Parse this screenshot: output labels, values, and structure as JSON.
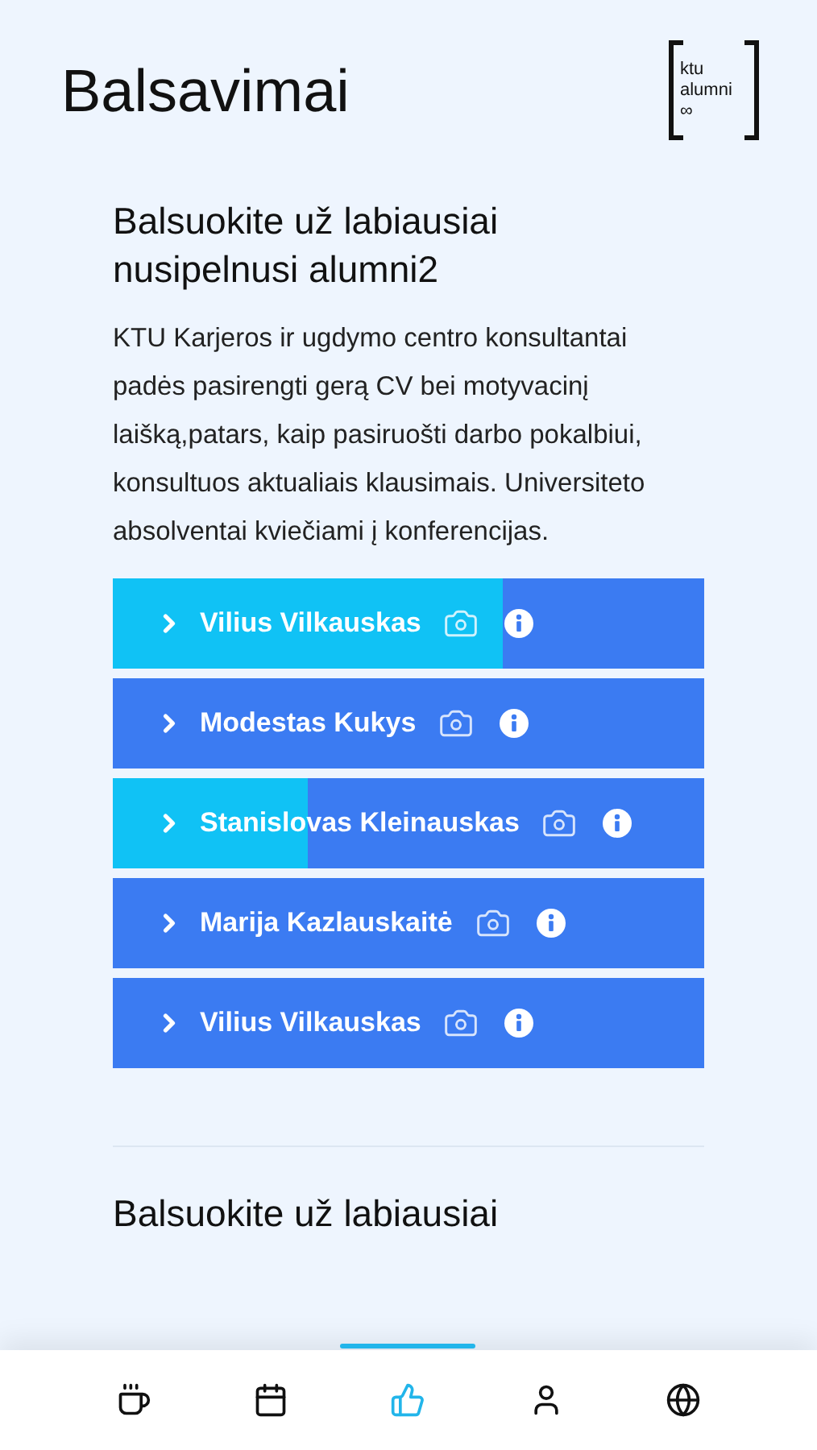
{
  "header": {
    "title": "Balsavimai",
    "logo": {
      "lines": [
        "ktu",
        "alumni",
        "∞"
      ]
    }
  },
  "polls": [
    {
      "title": "Balsuokite už labiausiai nusipelnusi alumni2",
      "description": "KTU Karjeros ir ugdymo centro konsultantai padės pasirengti gerą CV bei motyvacinį laišką,patars, kaip pasiruošti darbo pokalbiui, konsultuos aktualiais klausimais. Universiteto absolventai kviečiami į konferencijas.",
      "candidates": [
        {
          "name": "Vilius Vilkauskas",
          "level": 0.66
        },
        {
          "name": "Modestas Kukys",
          "level": 0
        },
        {
          "name": "Stanislovas Kleinauskas",
          "level": 0.33
        },
        {
          "name": "Marija Kazlauskaitė",
          "level": 0
        },
        {
          "name": "Vilius Vilkauskas",
          "level": 0
        }
      ]
    },
    {
      "title": "Balsuokite už labiausiai"
    }
  ],
  "nav": [
    {
      "kind": "coffee",
      "selected": false
    },
    {
      "kind": "calendar",
      "selected": false
    },
    {
      "kind": "thumbs-up",
      "selected": true
    },
    {
      "kind": "user",
      "selected": false
    },
    {
      "kind": "globe",
      "selected": false
    }
  ]
}
